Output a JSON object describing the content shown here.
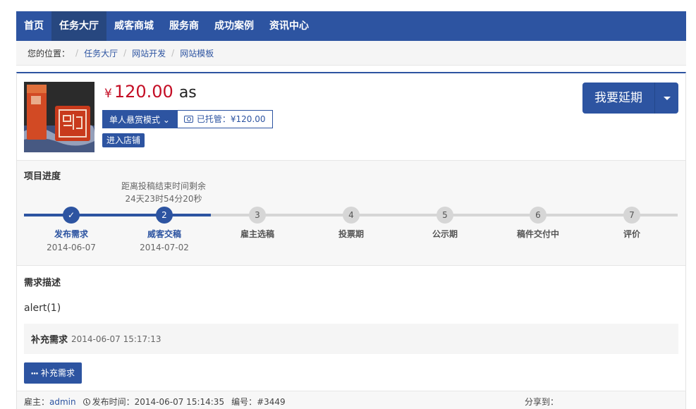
{
  "nav": {
    "items": [
      "首页",
      "任务大厅",
      "威客商城",
      "服务商",
      "成功案例",
      "资讯中心"
    ],
    "active_index": 1
  },
  "breadcrumb": {
    "prefix": "您的位置：",
    "items": [
      "任务大厅",
      "网站开发",
      "网站模板"
    ]
  },
  "task": {
    "currency_symbol": "¥",
    "price": "120.00",
    "title": "as",
    "mode_label": "单人悬赏模式",
    "escrow_label": "已托管：¥120.00",
    "shop_label": "进入店铺",
    "extend_label": "我要延期"
  },
  "progress": {
    "title": "项目进度",
    "countdown_label": "距离投稿结束时间剩余",
    "countdown_time": "24天23时54分20秒",
    "steps": [
      {
        "marker": "✓",
        "name": "发布需求",
        "date": "2014-06-07",
        "status": "done"
      },
      {
        "marker": "2",
        "name": "威客交稿",
        "date": "2014-07-02",
        "status": "current"
      },
      {
        "marker": "3",
        "name": "雇主选稿",
        "date": "",
        "status": "pending"
      },
      {
        "marker": "4",
        "name": "投票期",
        "date": "",
        "status": "pending"
      },
      {
        "marker": "5",
        "name": "公示期",
        "date": "",
        "status": "pending"
      },
      {
        "marker": "6",
        "name": "稿件交付中",
        "date": "",
        "status": "pending"
      },
      {
        "marker": "7",
        "name": "评价",
        "date": "",
        "status": "pending"
      }
    ],
    "completed_fraction": 0.286
  },
  "description": {
    "title": "需求描述",
    "text": "alert(1)",
    "supplement_title": "补充需求",
    "supplement_time": "2014-06-07 15:17:13",
    "supplement_button": "补充需求"
  },
  "meta": {
    "employer_label": "雇主：",
    "employer_name": "admin",
    "publish_label": "发布时间：2014-06-07 15:14:35",
    "number_label": "编号：#3449",
    "share_label": "分享到："
  },
  "colors": {
    "primary": "#2d54a1",
    "price": "#c40e25"
  }
}
